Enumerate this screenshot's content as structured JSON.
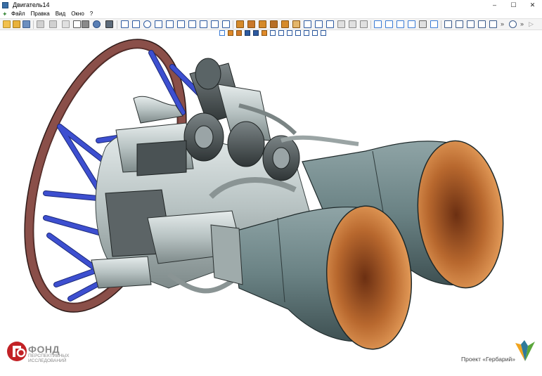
{
  "window": {
    "title": "Двигатель14",
    "minimize": "–",
    "maximize": "☐",
    "close": "✕"
  },
  "menu": [
    "Файл",
    "Правка",
    "Вид",
    "Окно",
    "?"
  ],
  "footer": {
    "org_title": "ФОНД",
    "org_subtitle_1": "ПЕРСПЕКТИВНЫХ",
    "org_subtitle_2": "ИССЛЕДОВАНИЙ",
    "project": "Проект «Гербарий»"
  },
  "colors": {
    "frame_ring": "#8a4f49",
    "struts": "#3d4fd0",
    "nozzle_outer": "#6a8284",
    "nozzle_inner": "#b8682e",
    "logo_red": "#c22226"
  }
}
